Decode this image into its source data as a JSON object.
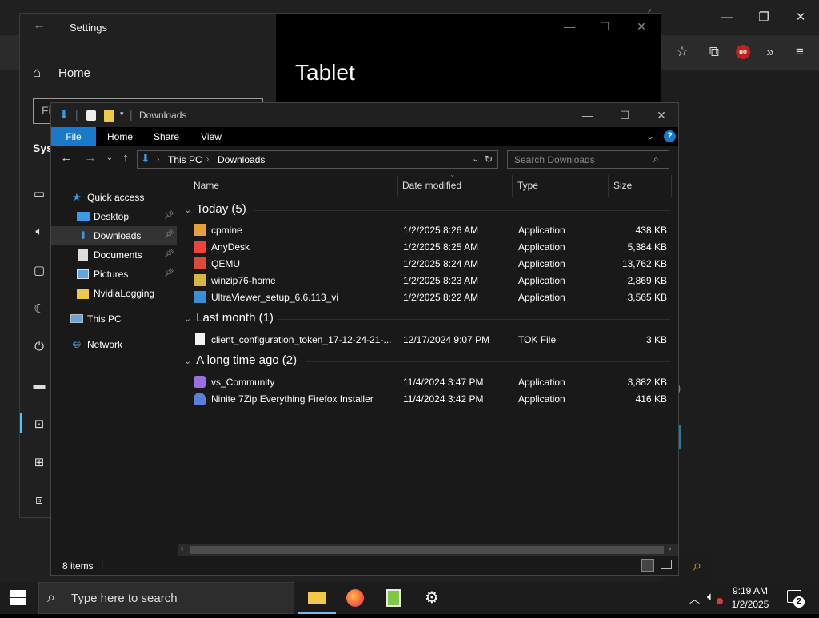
{
  "browser": {
    "tab_close": "✕",
    "toolbar_icons": [
      "star-icon",
      "extensions-icon",
      "ublock-icon",
      "overflow-icon",
      "menu-icon"
    ],
    "side_glyph": "l)"
  },
  "settings": {
    "title": "Settings",
    "home_label": "Home",
    "find_placeholder": "Fi",
    "section_label": "Syst",
    "page_heading": "Tablet"
  },
  "explorer": {
    "title": "Downloads",
    "ribbon_tabs": [
      "File",
      "Home",
      "Share",
      "View"
    ],
    "address": {
      "root": "This PC",
      "folder": "Downloads"
    },
    "search_placeholder": "Search Downloads",
    "nav": [
      {
        "label": "Quick access",
        "icon": "star-icon",
        "pinned": false
      },
      {
        "label": "Desktop",
        "icon": "desktop-folder-icon",
        "pinned": true
      },
      {
        "label": "Downloads",
        "icon": "download-folder-icon",
        "pinned": true,
        "selected": true
      },
      {
        "label": "Documents",
        "icon": "documents-folder-icon",
        "pinned": true
      },
      {
        "label": "Pictures",
        "icon": "pictures-folder-icon",
        "pinned": true
      },
      {
        "label": "NvidiaLogging",
        "icon": "folder-icon",
        "pinned": false
      },
      {
        "label": "This PC",
        "icon": "computer-icon",
        "pinned": false
      },
      {
        "label": "Network",
        "icon": "network-icon",
        "pinned": false
      }
    ],
    "columns": {
      "name": "Name",
      "date": "Date modified",
      "type": "Type",
      "size": "Size"
    },
    "groups": [
      {
        "label": "Today (5)",
        "files": [
          {
            "name": "cpmine",
            "date": "1/2/2025 8:26 AM",
            "type": "Application",
            "size": "438 KB",
            "icon": "cpmine-app-icon",
            "color": "#e5a23a"
          },
          {
            "name": "AnyDesk",
            "date": "1/2/2025 8:25 AM",
            "type": "Application",
            "size": "5,384 KB",
            "icon": "anydesk-app-icon",
            "color": "#ef443b"
          },
          {
            "name": "QEMU",
            "date": "1/2/2025 8:24 AM",
            "type": "Application",
            "size": "13,762 KB",
            "icon": "qemu-app-icon",
            "color": "#d94a3a"
          },
          {
            "name": "winzip76-home",
            "date": "1/2/2025 8:23 AM",
            "type": "Application",
            "size": "2,869 KB",
            "icon": "winzip-app-icon",
            "color": "#d6b640"
          },
          {
            "name": "UltraViewer_setup_6.6.113_vi",
            "date": "1/2/2025 8:22 AM",
            "type": "Application",
            "size": "3,565 KB",
            "icon": "ultraviewer-app-icon",
            "color": "#3b8fd6"
          }
        ]
      },
      {
        "label": "Last month (1)",
        "files": [
          {
            "name": "client_configuration_token_17-12-24-21-...",
            "date": "12/17/2024 9:07 PM",
            "type": "TOK File",
            "size": "3 KB",
            "icon": "file-icon",
            "color": "#f2f2f2"
          }
        ]
      },
      {
        "label": "A long time ago (2)",
        "files": [
          {
            "name": "vs_Community",
            "date": "11/4/2024 3:47 PM",
            "type": "Application",
            "size": "3,882 KB",
            "icon": "visual-studio-app-icon",
            "color": "#9b6ee6"
          },
          {
            "name": "Ninite 7Zip Everything Firefox Installer",
            "date": "11/4/2024 3:42 PM",
            "type": "Application",
            "size": "416 KB",
            "icon": "ninite-app-icon",
            "color": "#5b7fd9"
          }
        ]
      }
    ],
    "status_items": "8 items"
  },
  "taskbar": {
    "search_placeholder": "Type here to search",
    "time": "9:19 AM",
    "date": "1/2/2025",
    "notification_count": "2"
  }
}
